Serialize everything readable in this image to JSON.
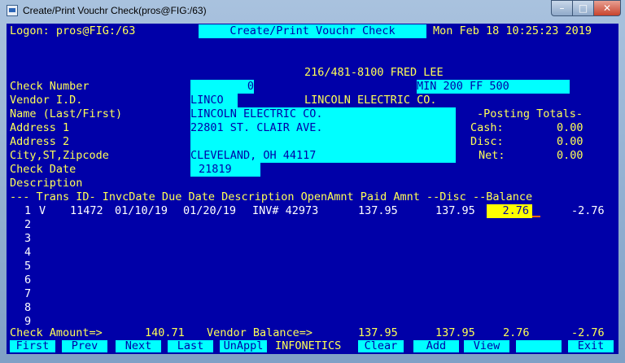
{
  "window": {
    "title": "Create/Print Vouchr Check(pros@FIG:/63)",
    "min": "–",
    "max": "□",
    "close": "✕"
  },
  "header": {
    "logon": "Logon: pros@FIG:/63",
    "screen_title": "Create/Print Vouchr Check",
    "datetime": "Mon Feb 18 10:25:23 2019"
  },
  "contact": "216/481-8100 FRED LEE",
  "labels": {
    "check_number": "Check Number",
    "vendor_id": "Vendor I.D.",
    "name": "Name (Last/First)",
    "address1": "Address 1",
    "address2": "Address 2",
    "city": "City,ST,Zipcode",
    "check_date": "Check Date",
    "description": "Description"
  },
  "fields": {
    "check_number": "0",
    "terms": "MIN 200 FF 500",
    "vendor_id": "LINCO",
    "vendor_name": "LINCOLN ELECTRIC CO.",
    "name": "LINCOLN ELECTRIC CO.",
    "address1": "22801 ST. CLAIR AVE.",
    "address2": "",
    "city": "CLEVELAND, OH 44117",
    "check_date": "21819",
    "description": ""
  },
  "posting": {
    "title": "-Posting Totals-",
    "cash_label": "Cash:",
    "cash": "0.00",
    "disc_label": "Disc:",
    "disc": "0.00",
    "net_label": "Net:",
    "net": "0.00"
  },
  "table": {
    "header": "--- Trans ID- InvcDate Due Date Description OpenAmnt Paid Amnt --Disc --Balance",
    "row1": {
      "num": "1",
      "type": "V",
      "trans_id": "11472",
      "invc_date": "01/10/19",
      "due_date": "01/20/19",
      "description": "INV# 42973",
      "open_amnt": "137.95",
      "paid_amnt": "137.95",
      "disc": "2.76",
      "balance": "-2.76"
    },
    "row_numbers": [
      "2",
      "3",
      "4",
      "5",
      "6",
      "7",
      "8",
      "9"
    ]
  },
  "footer": {
    "check_amount_label": "Check Amount=>",
    "check_amount": "140.71",
    "vendor_balance_label": "Vendor Balance=>",
    "open": "137.95",
    "paid": "137.95",
    "disc": "2.76",
    "balance": "-2.76"
  },
  "fkeys": {
    "first": "First",
    "prev": "Prev",
    "next": "Next",
    "last": "Last",
    "unappl": "UnAppl",
    "brand": "INFONETICS",
    "clear": "Clear",
    "add": "Add",
    "view": "View",
    "blank": "",
    "exit": "Exit"
  }
}
